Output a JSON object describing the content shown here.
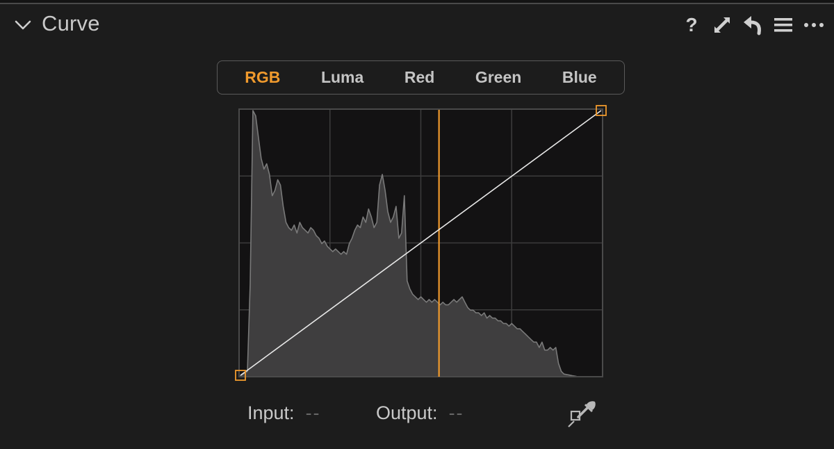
{
  "panel": {
    "title": "Curve",
    "tool_icons": [
      "help-icon",
      "expand-icon",
      "reset-icon",
      "menu-icon",
      "more-icon"
    ],
    "help_glyph": "?"
  },
  "channel_tabs": [
    {
      "label": "RGB",
      "active": true
    },
    {
      "label": "Luma",
      "active": false
    },
    {
      "label": "Red",
      "active": false
    },
    {
      "label": "Green",
      "active": false
    },
    {
      "label": "Blue",
      "active": false
    }
  ],
  "readout": {
    "input_label": "Input:",
    "input_value": "--",
    "output_label": "Output:",
    "output_value": "--"
  },
  "curve": {
    "points": [
      [
        0,
        0
      ],
      [
        1,
        1
      ]
    ],
    "cursor_input_fraction": 0.55
  },
  "histogram": [
    0.02,
    0.35,
    1.0,
    0.98,
    0.9,
    0.82,
    0.78,
    0.8,
    0.76,
    0.68,
    0.7,
    0.74,
    0.72,
    0.64,
    0.58,
    0.56,
    0.55,
    0.57,
    0.54,
    0.58,
    0.56,
    0.55,
    0.54,
    0.56,
    0.55,
    0.53,
    0.52,
    0.5,
    0.51,
    0.49,
    0.48,
    0.47,
    0.48,
    0.47,
    0.46,
    0.47,
    0.46,
    0.5,
    0.52,
    0.55,
    0.57,
    0.56,
    0.6,
    0.58,
    0.63,
    0.6,
    0.56,
    0.58,
    0.72,
    0.76,
    0.7,
    0.62,
    0.58,
    0.6,
    0.64,
    0.52,
    0.54,
    0.68,
    0.36,
    0.33,
    0.31,
    0.3,
    0.29,
    0.3,
    0.29,
    0.28,
    0.29,
    0.28,
    0.29,
    0.28,
    0.27,
    0.28,
    0.27,
    0.27,
    0.28,
    0.29,
    0.28,
    0.29,
    0.3,
    0.28,
    0.26,
    0.25,
    0.25,
    0.24,
    0.24,
    0.23,
    0.24,
    0.22,
    0.23,
    0.22,
    0.22,
    0.21,
    0.21,
    0.2,
    0.2,
    0.19,
    0.2,
    0.19,
    0.18,
    0.18,
    0.17,
    0.16,
    0.15,
    0.14,
    0.13,
    0.13,
    0.11,
    0.13,
    0.1,
    0.1,
    0.11,
    0.1,
    0.11,
    0.05,
    0.02,
    0.01,
    0.008,
    0.006,
    0.004,
    0.002,
    0.0,
    0.0,
    0.0,
    0.0,
    0.0,
    0.0,
    0.0,
    0.0,
    0.0,
    0.0
  ],
  "colors": {
    "accent": "#f09a2d",
    "plot_bg": "#131213",
    "grid": "#3c3c3c",
    "histogram_fill": "#3f3e3f",
    "histogram_stroke": "#7a7a7a",
    "curve_line": "#e8e8e8"
  }
}
